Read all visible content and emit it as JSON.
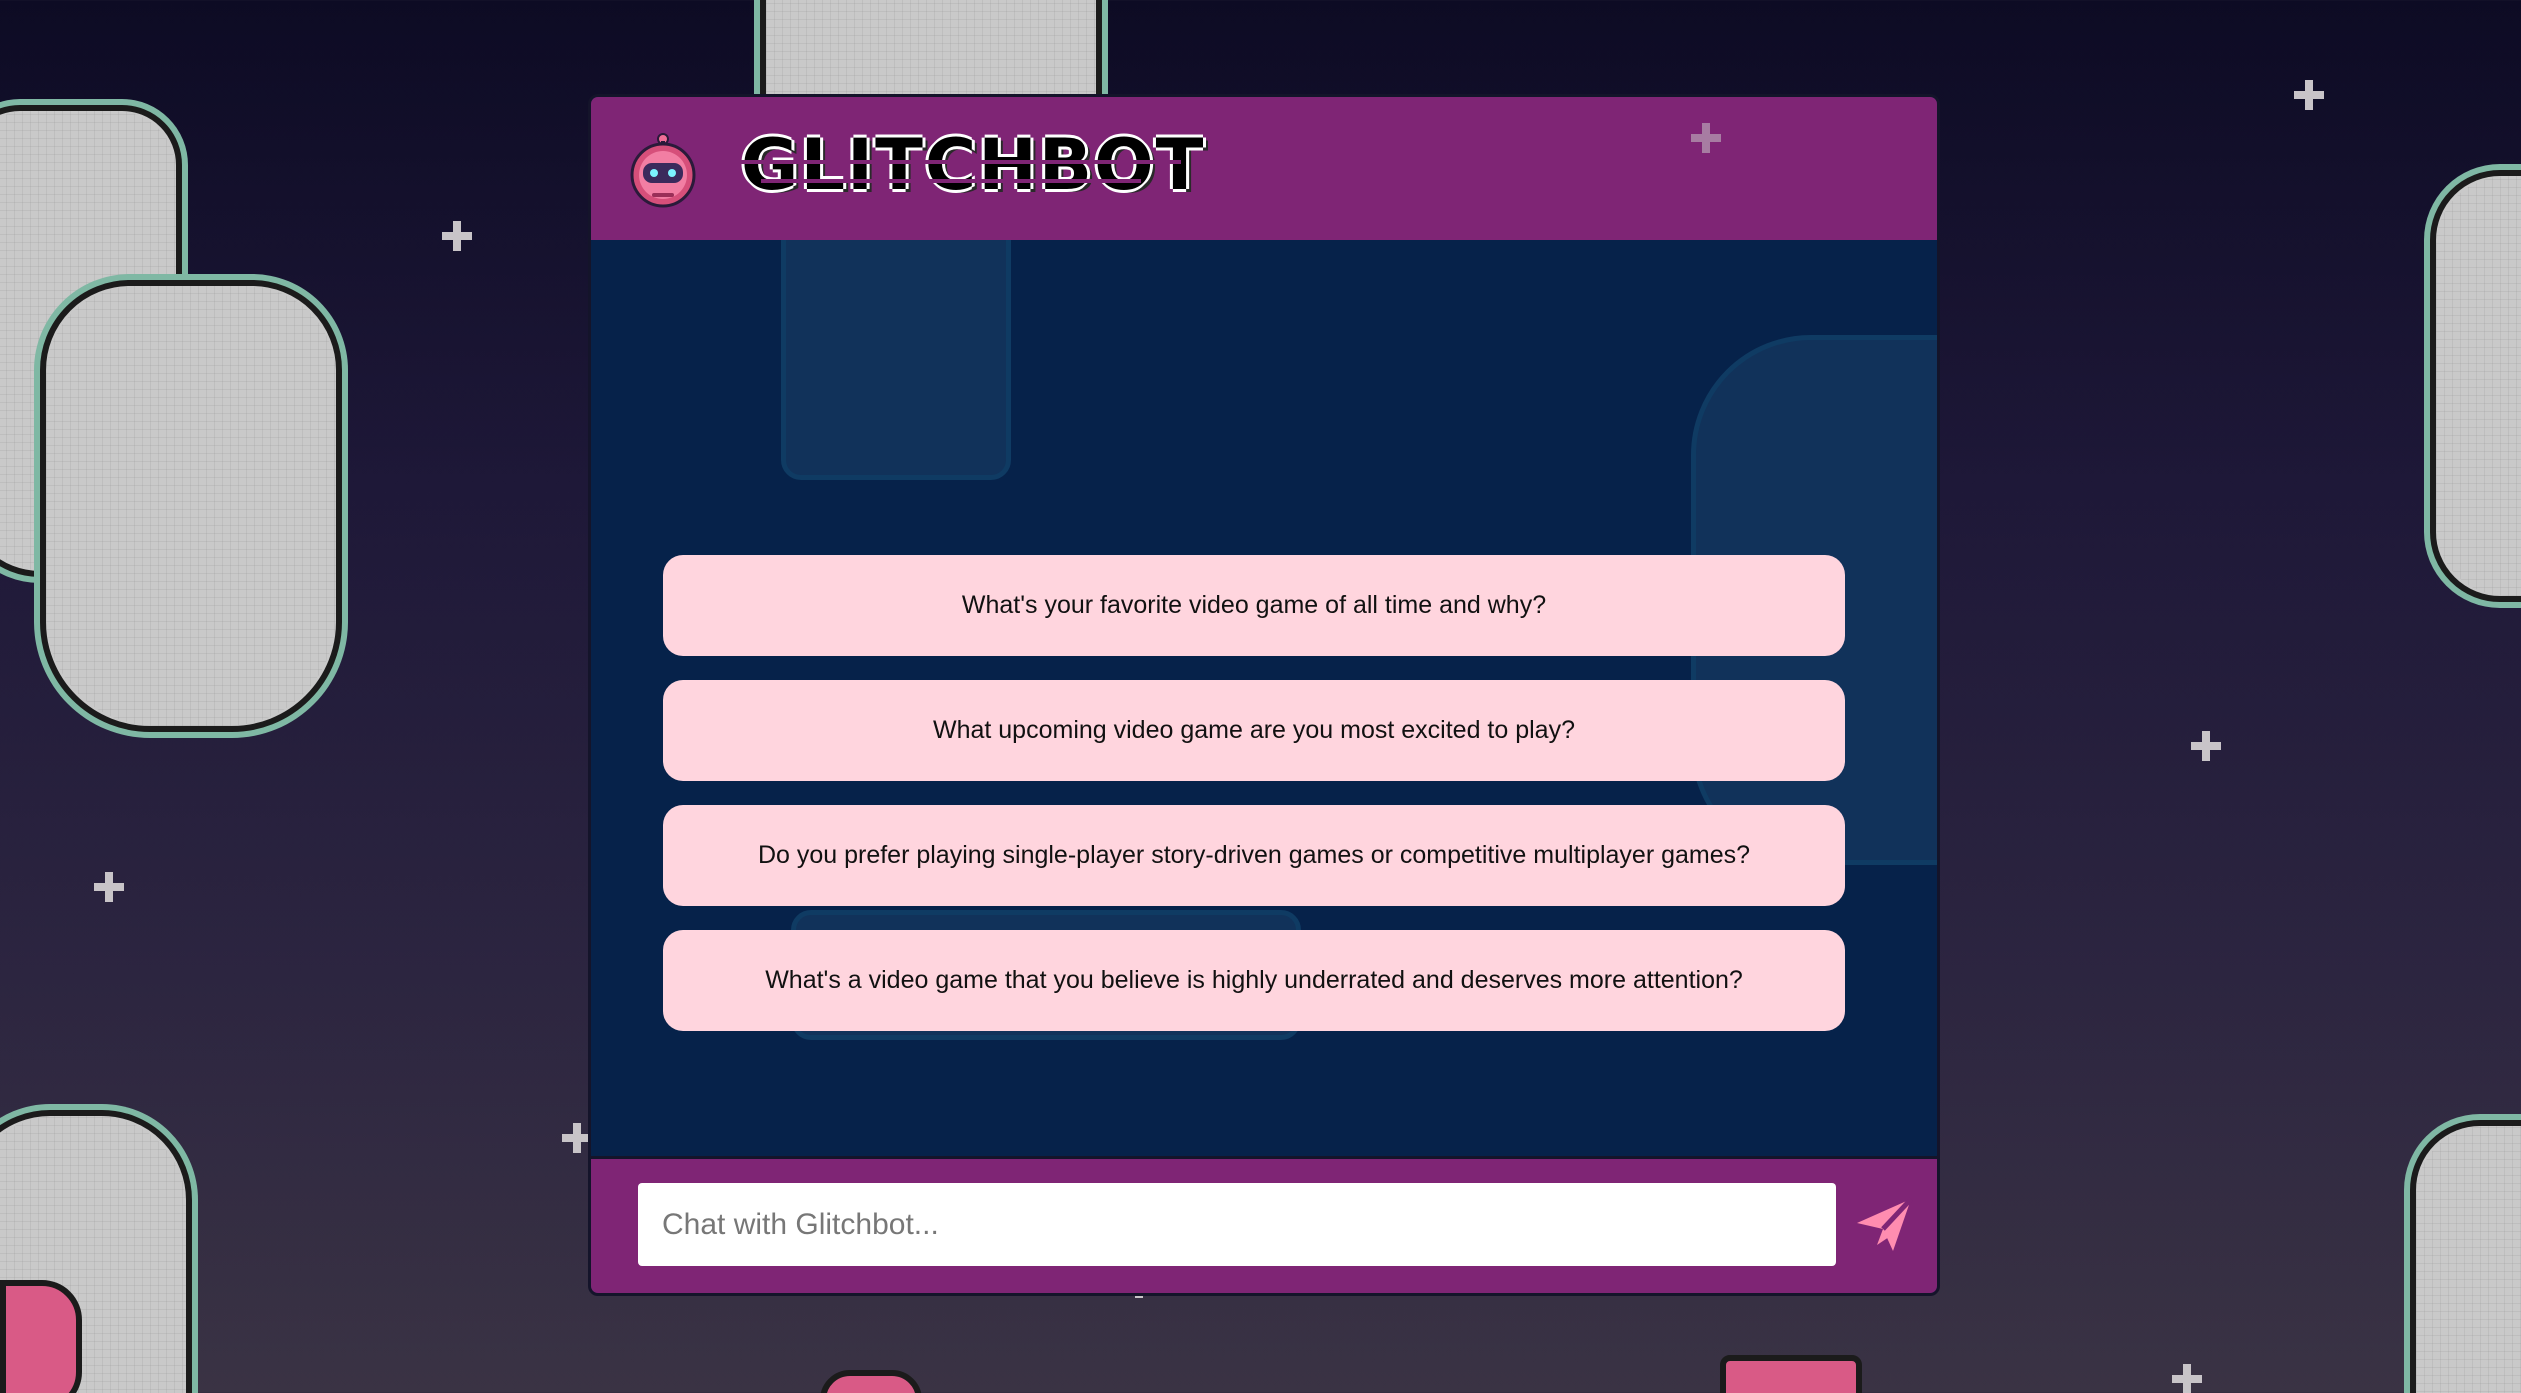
{
  "header": {
    "title": "GLITCHBOT",
    "avatar_icon": "robot-avatar-icon"
  },
  "suggestions": [
    {
      "label": "What's your favorite video game of all time and why?"
    },
    {
      "label": "What upcoming video game are you most excited to play?"
    },
    {
      "label": "Do you prefer playing single-player story-driven games or competitive multiplayer games?"
    },
    {
      "label": "What's a video game that you believe is highly underrated and deserves more attention?"
    }
  ],
  "input": {
    "placeholder": "Chat with Glitchbot...",
    "value": ""
  },
  "send": {
    "icon": "send-icon"
  },
  "colors": {
    "header_bg": "#7f2575",
    "body_bg": "#06224a",
    "suggestion_bg": "#ffd5de",
    "accent": "#ff8db0"
  }
}
